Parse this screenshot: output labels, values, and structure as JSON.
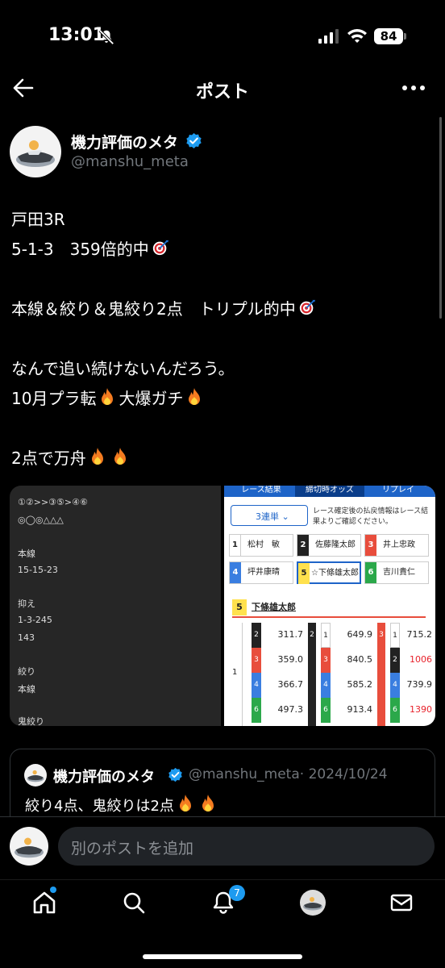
{
  "status_bar": {
    "time": "13:01",
    "battery": "84"
  },
  "nav": {
    "title": "ポスト"
  },
  "author": {
    "name": "機力評価のメタ",
    "handle": "@manshu_meta"
  },
  "post": {
    "lines": [
      "戸田3R",
      "5-1-3　359倍的中",
      "",
      "本線＆絞り＆鬼絞り2点　トリプル的中",
      "",
      "なんで追い続けないんだろう。",
      "10月プラ転",
      "",
      "2点で万舟"
    ],
    "line7_suffix": "大爆ガチ"
  },
  "media": {
    "left_lines": [
      "①②>>③⑤>④⑥",
      "◎◯◎△△△",
      "本線",
      "15-15-23",
      "抑え",
      "1-3-245",
      "143",
      "絞り",
      "本線",
      "鬼絞り"
    ],
    "tabs": [
      "レース結果",
      "締切時オッズ",
      "リプレイ"
    ],
    "bet_type": "3連単",
    "note": "レース確定後の払戻情報はレース結果よりご確認ください。",
    "racers": [
      {
        "num": "1",
        "name": "松村　敏"
      },
      {
        "num": "2",
        "name": "佐藤隆太郎"
      },
      {
        "num": "3",
        "name": "井上忠政"
      },
      {
        "num": "4",
        "name": "坪井康晴"
      },
      {
        "num": "5",
        "name": "☆下條雄太郎"
      },
      {
        "num": "6",
        "name": "吉川貴仁"
      }
    ],
    "selected": {
      "num": "5",
      "name": "下條雄太郎"
    },
    "odds_cols": [
      {
        "first": "1",
        "rows": [
          {
            "n": "2",
            "v": "311.7"
          },
          {
            "n": "3",
            "v": "359.0"
          },
          {
            "n": "4",
            "v": "366.7"
          },
          {
            "n": "6",
            "v": "497.3"
          }
        ]
      },
      {
        "first": "2",
        "rows": [
          {
            "n": "1",
            "v": "649.9"
          },
          {
            "n": "3",
            "v": "840.5"
          },
          {
            "n": "4",
            "v": "585.2"
          },
          {
            "n": "6",
            "v": "913.4"
          }
        ]
      },
      {
        "first": "3",
        "rows": [
          {
            "n": "1",
            "v": "715.2"
          },
          {
            "n": "2",
            "v": "1006"
          },
          {
            "n": "4",
            "v": "739.9"
          },
          {
            "n": "6",
            "v": "1390"
          }
        ]
      }
    ]
  },
  "quote": {
    "name": "機力評価のメタ",
    "handle": "@manshu_meta",
    "date": "· 2024/10/24",
    "text": "絞り4点、鬼絞りは2点"
  },
  "reply": {
    "placeholder": "別のポストを追加"
  },
  "tabbar": {
    "notification_count": "7"
  },
  "colors": {
    "accent": "#1d9bf0",
    "background": "#000000",
    "secondary_text": "#71767b"
  }
}
